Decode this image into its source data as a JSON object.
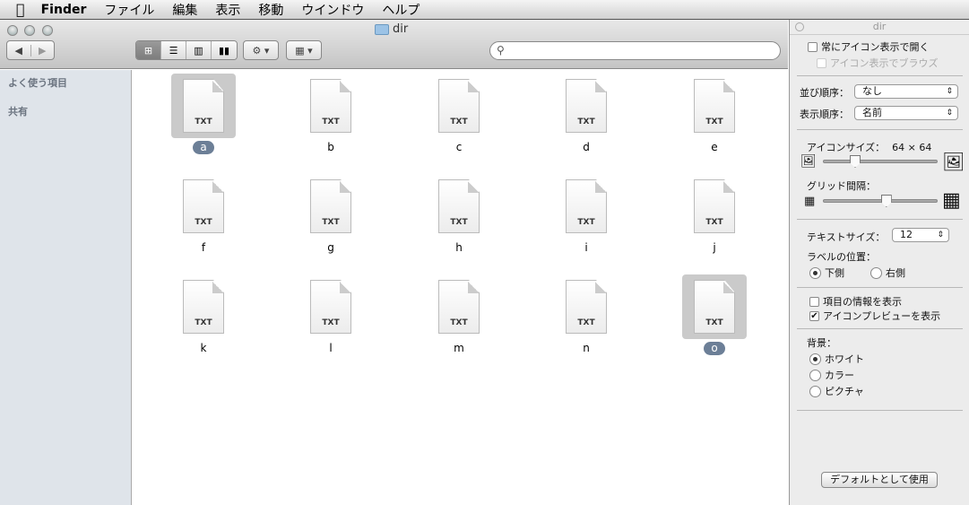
{
  "menubar": {
    "app": "Finder",
    "items": [
      "ファイル",
      "編集",
      "表示",
      "移動",
      "ウインドウ",
      "ヘルプ"
    ]
  },
  "window": {
    "title": "dir",
    "search_placeholder": ""
  },
  "sidebar": {
    "sections": [
      "よく使う項目",
      "共有"
    ]
  },
  "files": {
    "kind": "TXT",
    "items": [
      "a",
      "b",
      "c",
      "d",
      "e",
      "f",
      "g",
      "h",
      "i",
      "j",
      "k",
      "l",
      "m",
      "n",
      "o"
    ],
    "selected": [
      "a",
      "o"
    ]
  },
  "inspector": {
    "title": "dir",
    "always_open": "常にアイコン表示で開く",
    "always_open_checked": false,
    "browse": "アイコン表示でブラウズ",
    "browse_checked": false,
    "arrange_label": "並び順序：",
    "arrange_value": "なし",
    "sort_label": "表示順序：",
    "sort_value": "名前",
    "icon_size_label": "アイコンサイズ：",
    "icon_size_value": "64 × 64",
    "icon_size_fraction": 0.25,
    "grid_label": "グリッド間隔：",
    "grid_fraction": 0.55,
    "text_size_label": "テキストサイズ：",
    "text_size_value": "12",
    "label_pos_label": "ラベルの位置：",
    "label_bottom": "下側",
    "label_right": "右側",
    "show_info": "項目の情報を表示",
    "show_info_checked": false,
    "show_preview": "アイコンプレビューを表示",
    "show_preview_checked": true,
    "bg_label": "背景：",
    "bg_white": "ホワイト",
    "bg_color": "カラー",
    "bg_picture": "ピクチャ",
    "default_button": "デフォルトとして使用"
  }
}
